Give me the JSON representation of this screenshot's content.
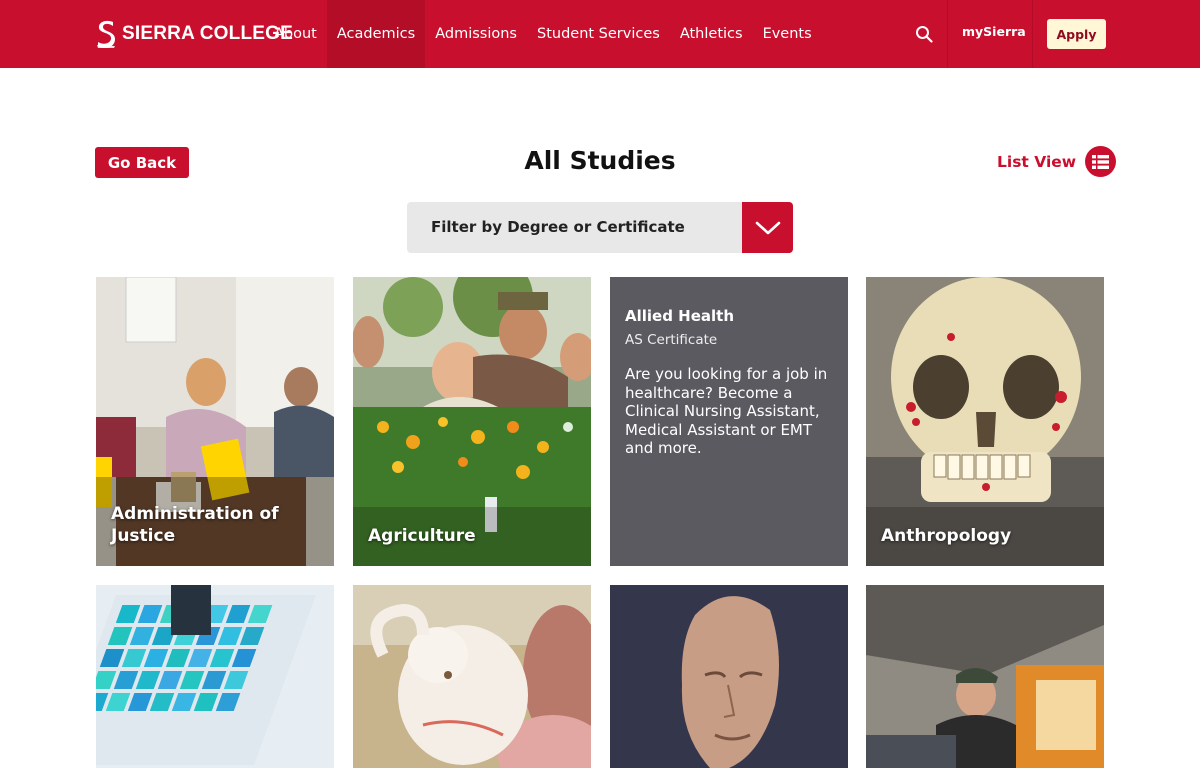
{
  "header": {
    "logo_text": "SIERRA COLLEGE",
    "nav": [
      "About",
      "Academics",
      "Admissions",
      "Student Services",
      "Athletics",
      "Events"
    ],
    "active_nav": "Academics",
    "mysierra_label": "mySierra",
    "apply_label": "Apply",
    "colors": {
      "brand": "#c8102e",
      "apply_bg": "#fff7d6"
    }
  },
  "page": {
    "go_back_label": "Go Back",
    "title": "All Studies",
    "list_view_label": "List View"
  },
  "filter": {
    "label": "Filter by Degree or Certificate"
  },
  "cards": [
    {
      "title": "Administration of Justice"
    },
    {
      "title": "Agriculture"
    },
    {
      "title": "Allied Health",
      "subtitle": "AS Certificate",
      "description": "Are you looking for a job in healthcare? Become a Clinical Nursing Assistant, Medical Assistant or EMT and more."
    },
    {
      "title": "Anthropology"
    },
    {
      "title": ""
    },
    {
      "title": ""
    },
    {
      "title": ""
    },
    {
      "title": ""
    }
  ],
  "icons": {
    "search": "search-icon",
    "list": "list-icon",
    "chevron": "chevron-down-icon",
    "logo": "sierra-logo-icon"
  }
}
